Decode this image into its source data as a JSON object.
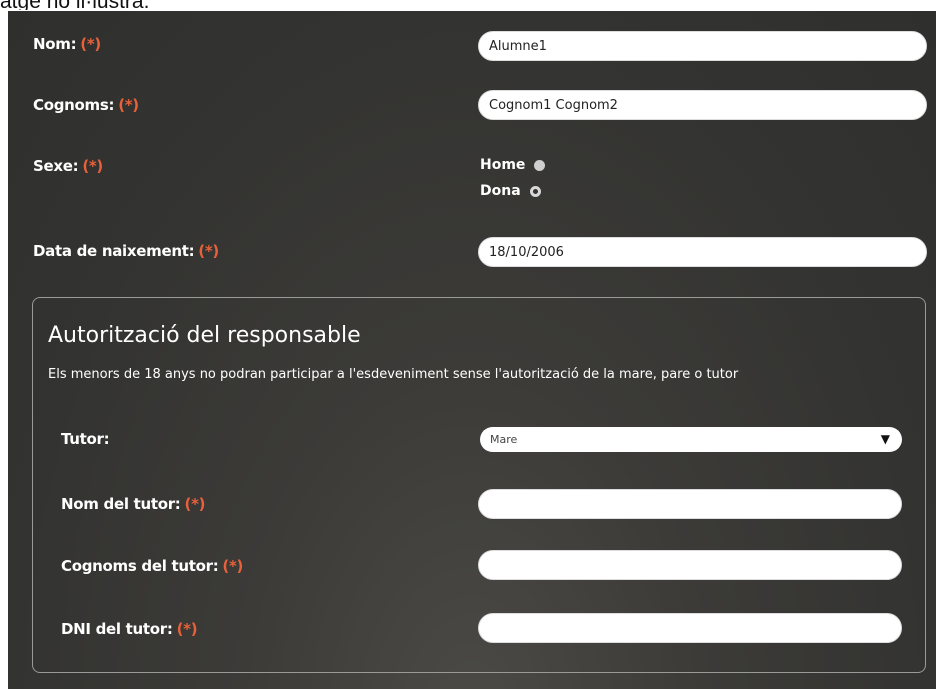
{
  "caption": "atge no il·lustra.",
  "required_mark": "(*)",
  "form": {
    "nom": {
      "label": "Nom:",
      "value": "Alumne1"
    },
    "cognoms": {
      "label": "Cognoms:",
      "value": "Cognom1 Cognom2"
    },
    "sexe": {
      "label": "Sexe:",
      "options": [
        {
          "label": "Home",
          "selected": false
        },
        {
          "label": "Dona",
          "selected": true
        }
      ]
    },
    "data_naixement": {
      "label": "Data de naixement:",
      "value": "18/10/2006"
    }
  },
  "authorization": {
    "title": "Autorització del responsable",
    "description": "Els menors de 18 anys no podran participar a l'esdeveniment sense l'autorització de la mare, pare o tutor",
    "tutor": {
      "label": "Tutor:",
      "selected": "Mare"
    },
    "nom_tutor": {
      "label": "Nom del tutor:",
      "value": ""
    },
    "cognoms_tutor": {
      "label": "Cognoms del tutor:",
      "value": ""
    },
    "dni_tutor": {
      "label": "DNI del tutor:",
      "value": ""
    }
  },
  "colors": {
    "panel": "#333331",
    "required": "#e8613a",
    "field_bg": "#ffffff"
  },
  "icons": {
    "select_arrow": "triangle-down-icon",
    "radio_on": "radio-selected-icon",
    "radio_off": "radio-unselected-icon"
  }
}
